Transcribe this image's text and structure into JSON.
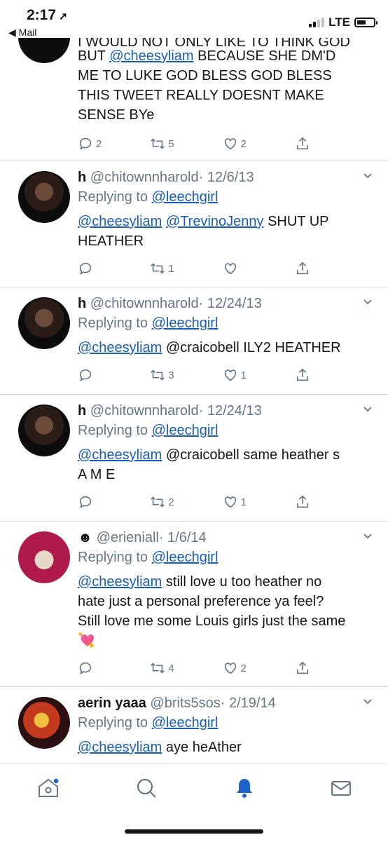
{
  "status": {
    "time": "2:17",
    "back": "◀ Mail",
    "network": "LTE"
  },
  "top_tweet": {
    "lines": [
      "I WOULD NOT ONLY LIKE TO THINK GOD",
      "BUT ",
      "@cheesyliam",
      " BECAUSE SHE DM'D",
      "ME TO LUKE GOD BLESS GOD BLESS",
      "THIS TWEET REALLY DOESNT MAKE",
      "SENSE BYe"
    ],
    "replies": "2",
    "retweets": "5",
    "likes": "2"
  },
  "tweets": [
    {
      "name": "h",
      "handle": "@chitownnharold",
      "date": "· 12/6/13",
      "replying_label": "Replying to",
      "replying_to": "@leechgirl",
      "mention1": "@cheesyliam",
      "mention2": "@TrevinoJenny",
      "text1": " SHUT UP",
      "text2": "HEATHER",
      "replies": "",
      "retweets": "1",
      "likes": ""
    },
    {
      "name": "h",
      "handle": "@chitownnharold",
      "date": "· 12/24/13",
      "replying_label": "Replying to",
      "replying_to": "@leechgirl",
      "mention1": "@cheesyliam",
      "text1": " @craicobell ILY2 HEATHER",
      "replies": "",
      "retweets": "3",
      "likes": "1"
    },
    {
      "name": "h",
      "handle": "@chitownnharold",
      "date": "· 12/24/13",
      "replying_label": "Replying to",
      "replying_to": "@leechgirl",
      "mention1": "@cheesyliam",
      "text1": " @craicobell same heather s",
      "text2": "A M E",
      "replies": "",
      "retweets": "2",
      "likes": "1"
    },
    {
      "name": "☻",
      "handle": "@erieniall",
      "date": "· 1/6/14",
      "replying_label": "Replying to",
      "replying_to": "@leechgirl",
      "mention1": "@cheesyliam",
      "text1": " still love u too heather no",
      "text2": "hate just a personal preference ya feel?",
      "text3": "Still love me some Louis girls just the same",
      "emoji": "💘",
      "replies": "",
      "retweets": "4",
      "likes": "2"
    },
    {
      "name": "aerin yaaa",
      "handle": "@brits5sos",
      "date": "· 2/19/14",
      "replying_label": "Replying to",
      "replying_to": "@leechgirl",
      "mention1": "@cheesyliam",
      "text1": " aye heAther"
    }
  ],
  "colors": {
    "link": "#1b5fb4",
    "muted": "#657786",
    "accent": "#1d62c8"
  },
  "icons": [
    "home-icon",
    "search-icon",
    "bell-icon",
    "mail-icon"
  ]
}
